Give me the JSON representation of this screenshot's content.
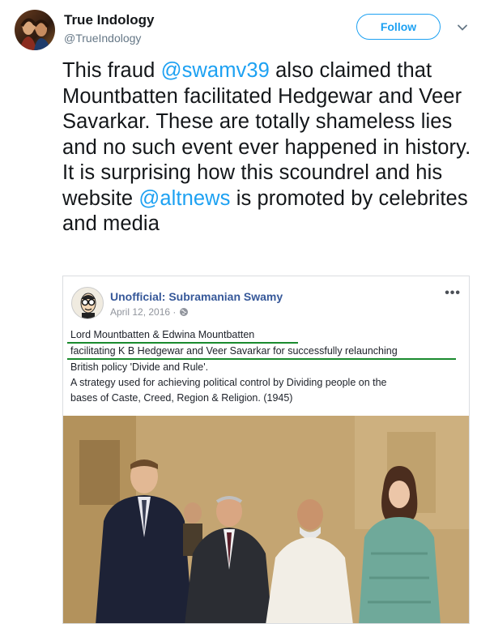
{
  "tweet": {
    "author_name": "True Indology",
    "author_handle": "@TrueIndology",
    "follow_label": "Follow",
    "text_parts": [
      "This fraud ",
      "@swamv39",
      " also claimed that Mountbatten facilitated Hedgewar and Veer Savarkar. These are totally shameless lies and no such event ever happened in history. It is surprising how this scoundrel and his website ",
      "@altnews",
      " is promoted by celebrites and media"
    ]
  },
  "embedded_post": {
    "page_name": "Unofficial: Subramanian Swamy",
    "date": "April 12, 2016 · ",
    "lines": [
      "Lord Mountbatten & Edwina Mountbatten",
      "facilitating K B Hedgewar and Veer Savarkar for successfully relaunching",
      "British policy 'Divide and Rule'.",
      "A strategy used for achieving political control by Dividing people on the",
      "bases of Caste, Creed, Region & Religion. (1945)"
    ],
    "more_icon": "ellipsis-icon",
    "privacy_icon": "globe-icon"
  },
  "colors": {
    "accent": "#1da1f2",
    "fb_link": "#365899",
    "highlight_underline": "#1a8a2e"
  }
}
